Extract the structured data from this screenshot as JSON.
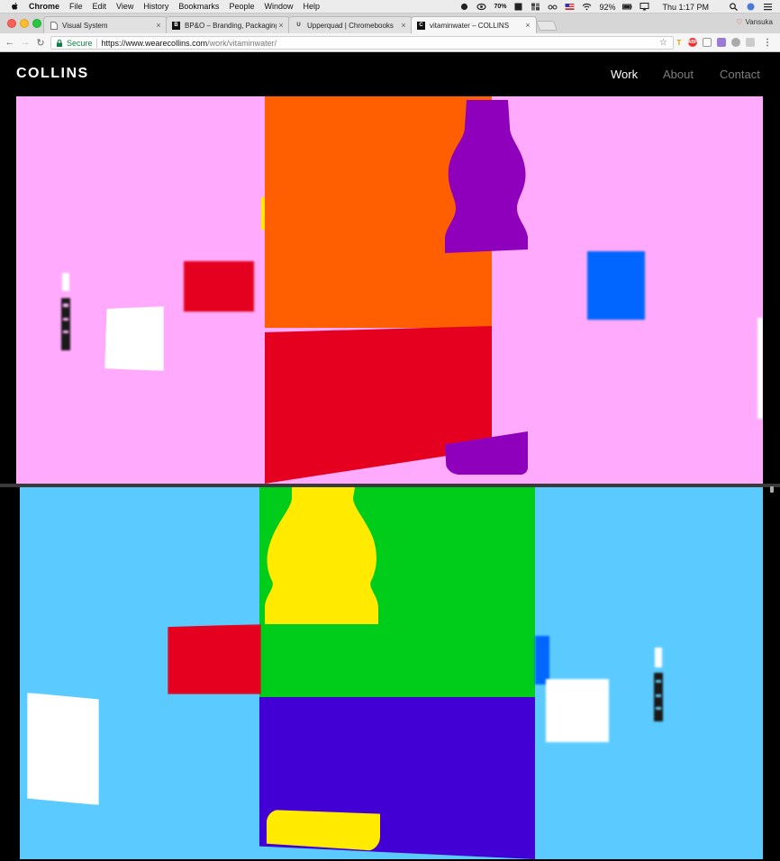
{
  "macos_menubar": {
    "menus": [
      "Chrome",
      "File",
      "Edit",
      "View",
      "History",
      "Bookmarks",
      "People",
      "Window",
      "Help"
    ],
    "battery": "92%",
    "clock": "Thu 1:17 PM",
    "weather": "70%"
  },
  "browser": {
    "tabs": [
      {
        "title": "Visual System",
        "favicon": "doc-icon"
      },
      {
        "title": "BP&O – Branding, Packaging a",
        "favicon": "bpo-icon"
      },
      {
        "title": "Upperquad  |  Chromebooks",
        "favicon": "u-icon"
      },
      {
        "title": "vitaminwater – COLLINS",
        "favicon": "c-icon"
      }
    ],
    "active_tab_index": 3,
    "close_glyph": "×",
    "profile_name": "Vansuka",
    "secure_label": "Secure",
    "url_host": "https://www.wearecollins.com",
    "url_path": "/work/vitaminwater/"
  },
  "site": {
    "logo": "COLLINS",
    "nav": {
      "work": "Work",
      "about": "About",
      "contact": "Contact"
    },
    "active_nav": "Work"
  },
  "colors": {
    "pink_bg": "#ffaafc",
    "blue_bg": "#5bcbff",
    "orange": "#ff5f00",
    "red": "#e6001f",
    "purple": "#8e00bb",
    "blue": "#0066ff",
    "green": "#00cc1a",
    "indigo": "#4200d4",
    "yellow": "#ffea00",
    "white": "#ffffff"
  }
}
